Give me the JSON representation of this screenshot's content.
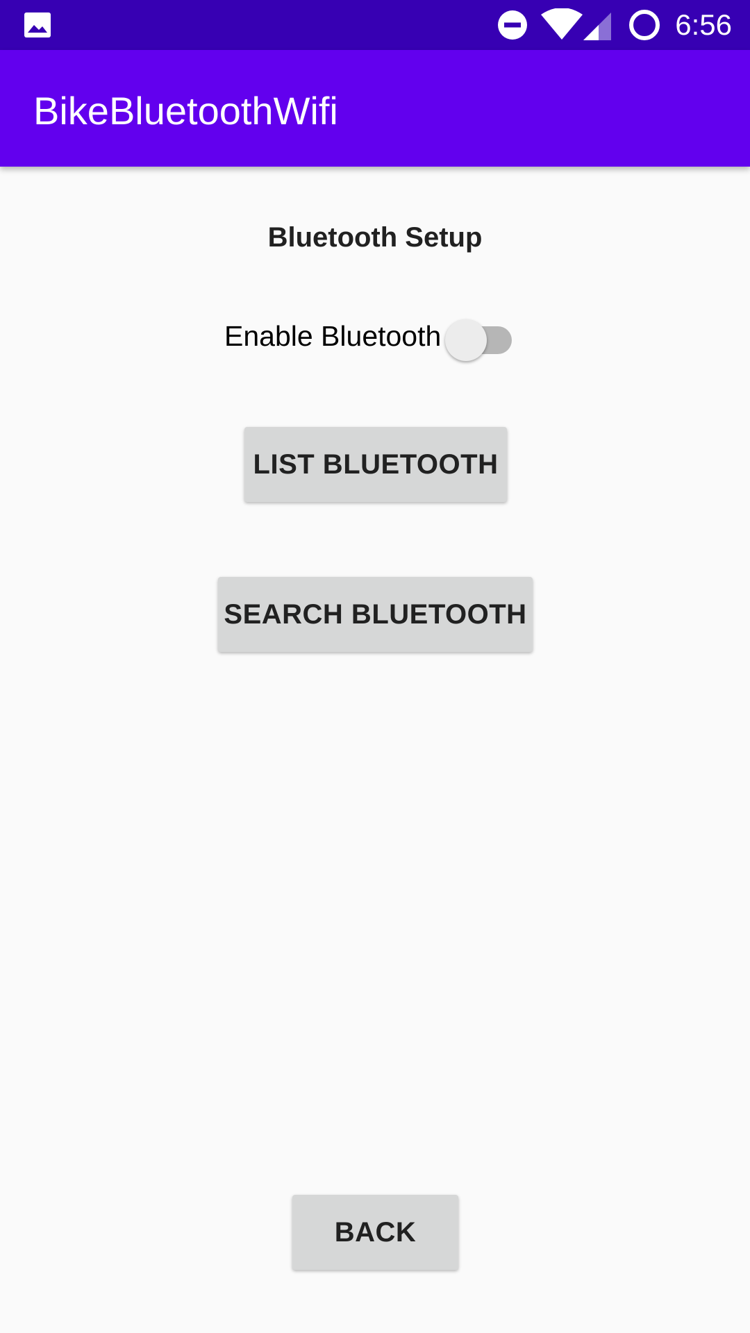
{
  "status_bar": {
    "time": "6:56",
    "icons": [
      "gallery-icon",
      "do-not-disturb-icon",
      "wifi-icon",
      "cell-signal-icon",
      "battery-icon"
    ]
  },
  "app_bar": {
    "title": "BikeBluetoothWifi"
  },
  "content": {
    "section_title": "Bluetooth Setup",
    "toggle": {
      "label": "Enable Bluetooth",
      "checked": false
    },
    "buttons": {
      "list_label": "LIST BLUETOOTH",
      "search_label": "SEARCH BLUETOOTH",
      "back_label": "BACK"
    }
  },
  "colors": {
    "status_bar": "#3700b3",
    "app_bar": "#6200ee",
    "background": "#fafafa",
    "button": "#d6d7d7",
    "switch_track": "#b6b6b6",
    "switch_thumb": "#ececec"
  }
}
